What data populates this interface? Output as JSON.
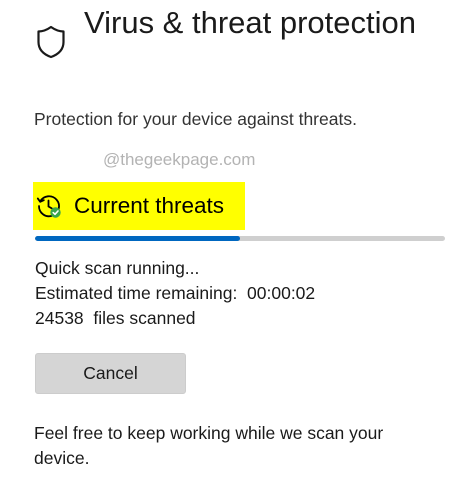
{
  "header": {
    "title": "Virus & threat protection",
    "subtitle": "Protection for your device against threats.",
    "watermark": "@thegeekpage.com",
    "icon": "shield-icon"
  },
  "current_threats": {
    "title": "Current threats",
    "icon": "history-check-icon",
    "highlight_color": "#ffff00",
    "progress": {
      "fraction": 0.5,
      "fill_color": "#0067c0",
      "track_color": "#cfcfcf"
    },
    "status_line": "Quick scan running...",
    "time_remaining": "Estimated time remaining:  00:00:02",
    "files_scanned": "24538  files scanned",
    "cancel_label": "Cancel",
    "footer_note": "Feel free to keep working while we scan your device."
  }
}
